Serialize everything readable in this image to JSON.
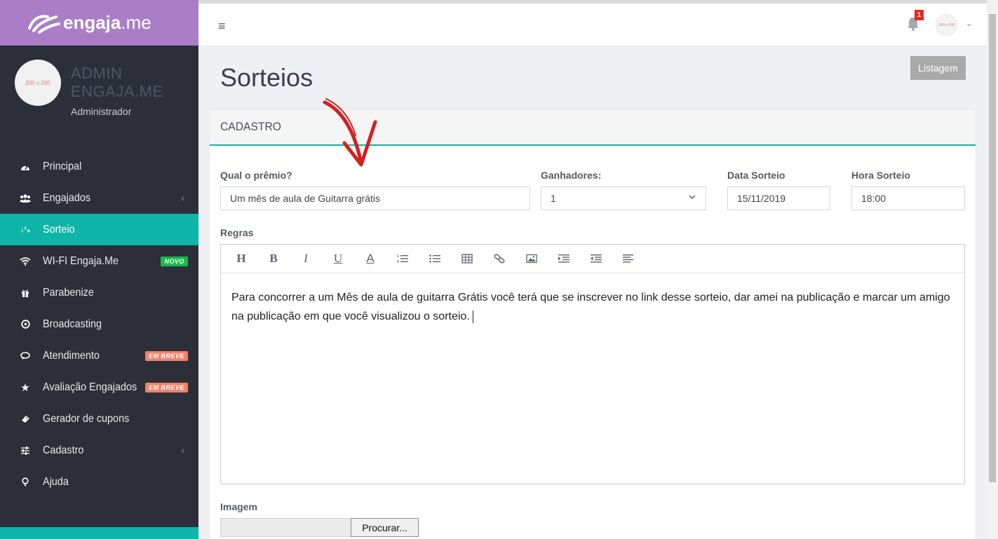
{
  "brand": {
    "name_bold": "engaja",
    "name_light": ".me"
  },
  "profile": {
    "avatar_text": "200 x 200",
    "name": "ADMIN ENGAJA.ME",
    "role": "Administrador"
  },
  "sidebar": {
    "items": [
      {
        "label": "Principal",
        "icon": "dashboard-icon"
      },
      {
        "label": "Engajados",
        "icon": "users-icon",
        "chevron": "‹"
      },
      {
        "label": "Sorteio",
        "icon": "sort-icon"
      },
      {
        "label": "WI-FI Engaja.Me",
        "icon": "wifi-icon",
        "badge": "NOVO"
      },
      {
        "label": "Parabenize",
        "icon": "gift-icon"
      },
      {
        "label": "Broadcasting",
        "icon": "broadcast-icon"
      },
      {
        "label": "Atendimento",
        "icon": "chat-icon",
        "badge": "EM BREVE"
      },
      {
        "label": "Avaliação Engajados",
        "icon": "star-icon",
        "badge": "EM BREVE"
      },
      {
        "label": "Gerador de cupons",
        "icon": "ticket-icon"
      },
      {
        "label": "Cadastro",
        "icon": "sliders-icon",
        "chevron": "‹"
      },
      {
        "label": "Ajuda",
        "icon": "lightbulb-icon"
      }
    ]
  },
  "topbar": {
    "menu_glyph": "≡",
    "notification_count": "1",
    "avatar_text": "200 x 200",
    "caret": "⌄"
  },
  "page": {
    "title": "Sorteios",
    "list_button": "Listagem"
  },
  "panel": {
    "heading": "CADASTRO"
  },
  "form": {
    "prize_label": "Qual o prêmio?",
    "prize_value": "Um mês de aula de Guitarra grátis",
    "winners_label": "Ganhadores:",
    "winners_value": "1",
    "date_label": "Data Sorteio",
    "date_value": "15/11/2019",
    "time_label": "Hora Sorteio",
    "time_value": "18:00",
    "rules_label": "Regras",
    "rules_text_line1": "Para concorrer a um Mês de aula de guitarra Grátis você terá que se inscrever no link desse sorteio, dar amei na publicação e marcar um amigo",
    "rules_text_line2": "na publicação em que você visualizou o sorteio.",
    "image_label": "Imagem",
    "browse_button": "Procurar..."
  },
  "toolbar": {
    "heading": "H",
    "bold": "B",
    "italic": "I",
    "underline": "U",
    "font_color": "A"
  },
  "colors": {
    "brand": "#a97ec7",
    "sidebar_bg": "#2c2f3a",
    "accent": "#0fb5a8",
    "badge_new": "#19b84c",
    "badge_soon": "#f2826a",
    "notification": "#e8281e",
    "annotation_arrow": "#d81e1e"
  }
}
